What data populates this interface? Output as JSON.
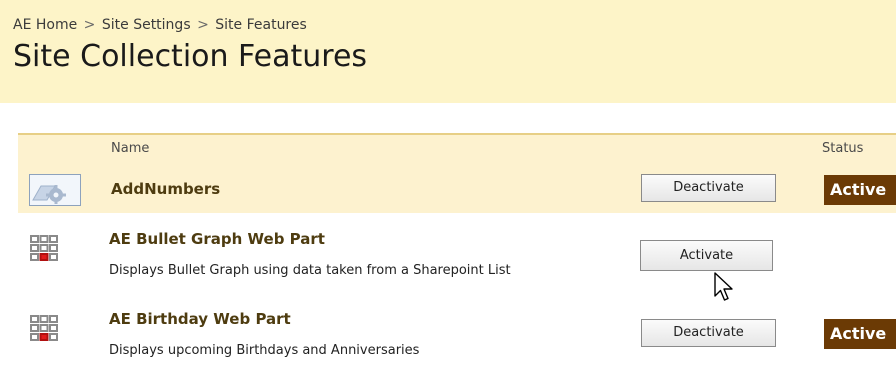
{
  "breadcrumb": {
    "items": [
      "AE Home",
      "Site Settings",
      "Site Features"
    ],
    "separator": ">"
  },
  "page_title": "Site Collection Features",
  "table": {
    "columns": {
      "name": "Name",
      "status": "Status"
    },
    "rows": [
      {
        "icon": "feature-gear-icon",
        "title": "AddNumbers",
        "description": "",
        "button": "Deactivate",
        "status": "Active"
      },
      {
        "icon": "web-part-grid-icon",
        "title": "AE Bullet Graph Web Part",
        "description": "Displays Bullet Graph using data taken from a Sharepoint List",
        "button": "Activate",
        "status": ""
      },
      {
        "icon": "web-part-grid-icon",
        "title": "AE Birthday Web Part",
        "description": "Displays upcoming Birthdays and Anniversaries",
        "button": "Deactivate",
        "status": "Active"
      }
    ]
  },
  "colors": {
    "header_bg": "#fdf4c8",
    "row_highlight": "#fdf2cf",
    "title_text": "#4e3c10",
    "active_badge": "#6b3a05"
  }
}
